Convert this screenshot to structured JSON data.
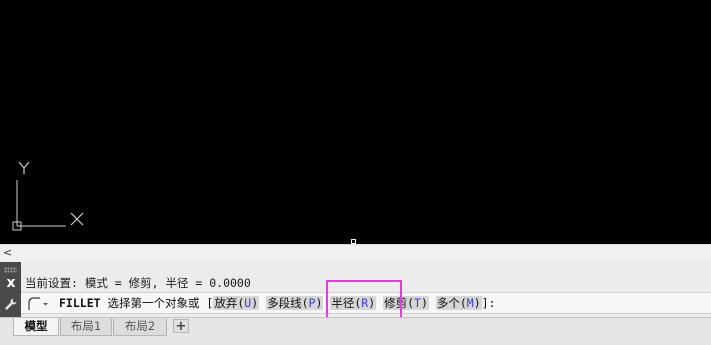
{
  "scrollbar": {
    "left_arrow": "<"
  },
  "command_line": {
    "history": "当前设置: 模式 = 修剪, 半径 = 0.0000",
    "close_label": "x",
    "command_name": "FILLET",
    "prompt": " 选择第一个对象或 [",
    "options": [
      {
        "label": "放弃(",
        "key": "U",
        "tail": ")"
      },
      {
        "label": "多段线(",
        "key": "P",
        "tail": ")"
      },
      {
        "label": "半径(",
        "key": "R",
        "tail": ")"
      },
      {
        "label": "修剪(",
        "key": "T",
        "tail": ")"
      },
      {
        "label": "多个(",
        "key": "M",
        "tail": ")"
      }
    ],
    "prompt_end": "]:"
  },
  "layout_tabs": [
    {
      "label": "模型",
      "active": true
    },
    {
      "label": "布局1",
      "active": false
    },
    {
      "label": "布局2",
      "active": false
    }
  ],
  "add_tab_label": "+",
  "ucs": {
    "x_label": "X",
    "y_label": "Y"
  },
  "colors": {
    "highlight": "#e63adf",
    "option_key": "#3a40c8"
  }
}
